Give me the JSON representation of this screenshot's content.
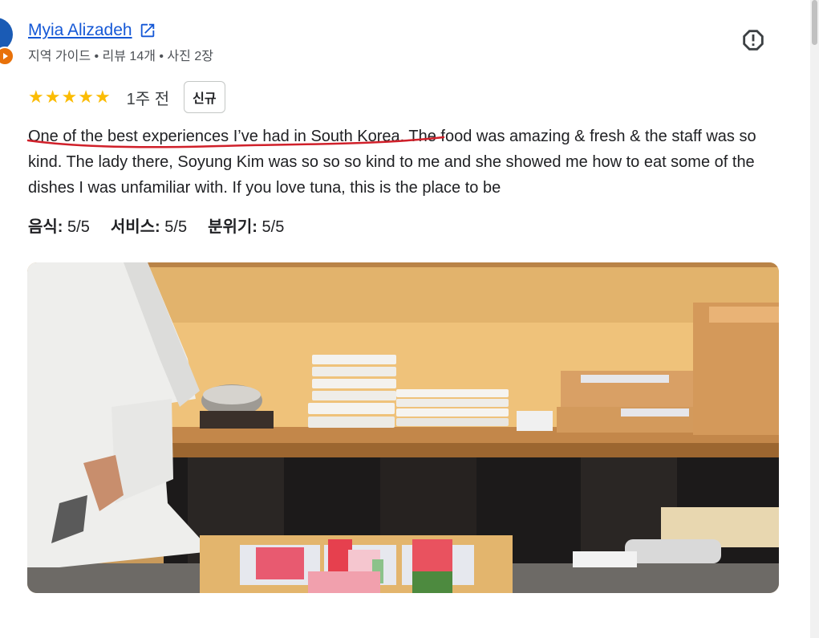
{
  "author": {
    "name": "Myia Alizadeh",
    "meta": "지역 가이드 • 리뷰 14개 • 사진 2장"
  },
  "review": {
    "stars": 5,
    "time": "1주 전",
    "badge": "신규",
    "text_highlight": "One of the best experiences I’ve had in South Korea",
    "text_rest": ". The food was amazing & fresh & the staff was so kind. The lady there, Soyung Kim was so so so kind to me and she showed me how to eat some of the dishes I was unfamiliar with. If you love tuna, this is the place to be",
    "sub_ratings": [
      {
        "label": "음식:",
        "value": "5/5"
      },
      {
        "label": "서비스:",
        "value": "5/5"
      },
      {
        "label": "분위기:",
        "value": "5/5"
      }
    ]
  },
  "icons": {
    "external_link": "external-link-icon",
    "report": "report-icon",
    "star": "star-icon"
  },
  "colors": {
    "link": "#1558d6",
    "star": "#fbbc04",
    "highlight_underline": "#d0202a"
  }
}
